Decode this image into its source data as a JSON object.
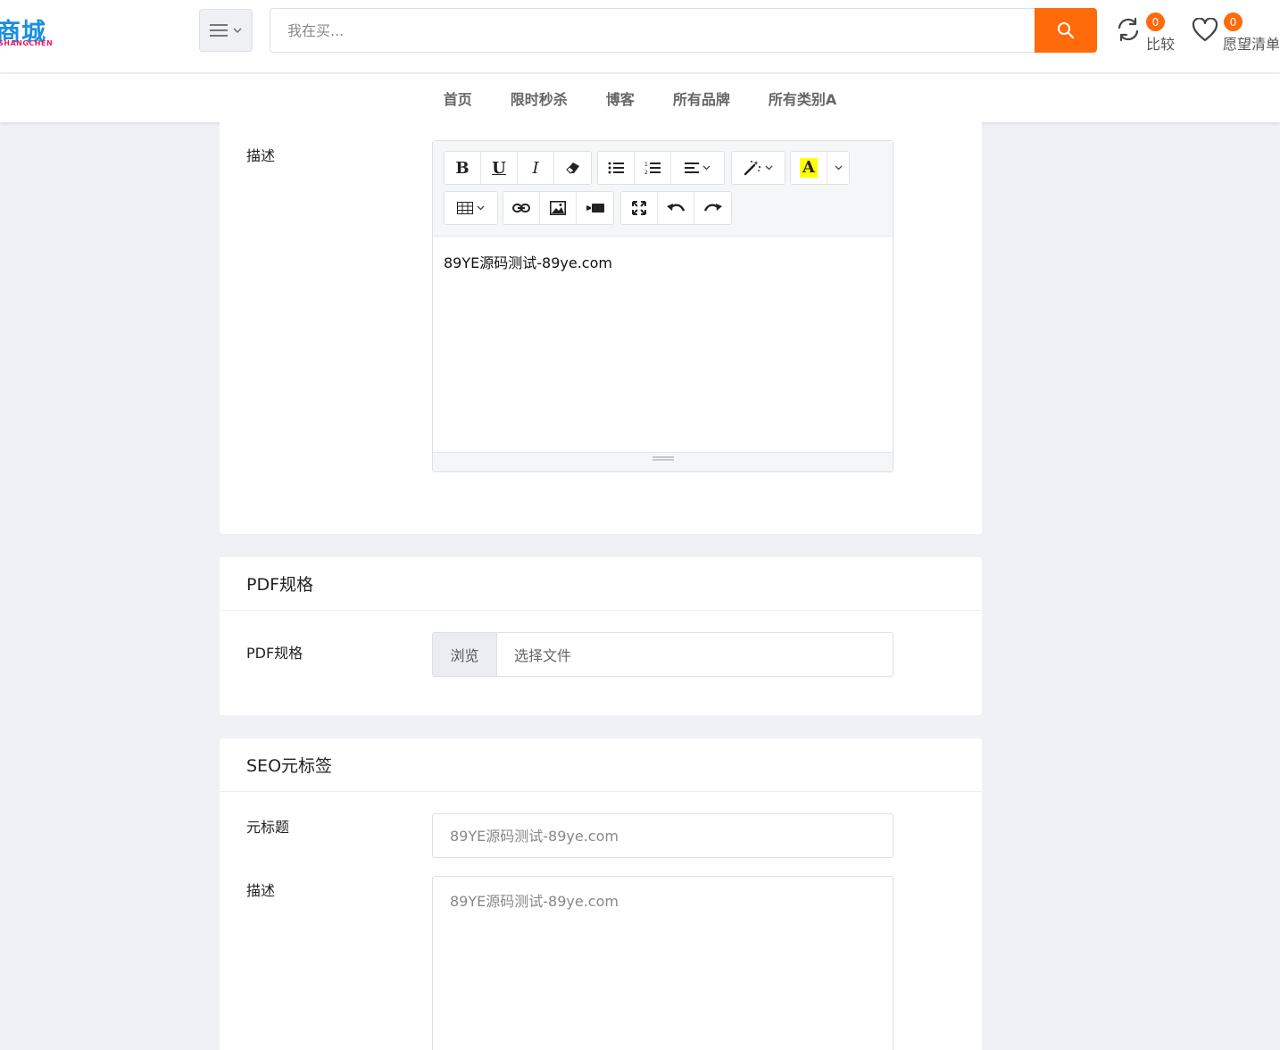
{
  "header": {
    "logo_text": "商城",
    "logo_sub": "SHANGCHENG",
    "search_placeholder": "我在买...",
    "compare": {
      "count": "0",
      "label": "比较"
    },
    "wishlist": {
      "count": "0",
      "label": "愿望清单"
    }
  },
  "nav": {
    "items": [
      "首页",
      "限时秒杀",
      "博客",
      "所有品牌",
      "所有类别A"
    ]
  },
  "description_section": {
    "label": "描述",
    "editor_content": "89YE源码测试-89ye.com",
    "toolbar_icons": [
      "bold-icon",
      "underline-icon",
      "italic-icon",
      "eraser-icon",
      "bullet-list-icon",
      "numbered-list-icon",
      "align-icon",
      "magic-wand-icon",
      "text-color-icon",
      "table-icon",
      "link-icon",
      "image-icon",
      "video-icon",
      "fullscreen-icon",
      "undo-icon",
      "redo-icon"
    ]
  },
  "pdf_section": {
    "title": "PDF规格",
    "label": "PDF规格",
    "browse_label": "浏览",
    "file_placeholder": "选择文件"
  },
  "seo_section": {
    "title": "SEO元标签",
    "meta_title_label": "元标题",
    "meta_title_placeholder": "89YE源码测试-89ye.com",
    "description_label": "描述",
    "description_placeholder": "89YE源码测试-89ye.com"
  },
  "colors": {
    "accent": "#ff6a0a",
    "logo_blue": "#1a8fe3",
    "logo_pink": "#e0206a",
    "page_bg": "#f0f1f6"
  }
}
